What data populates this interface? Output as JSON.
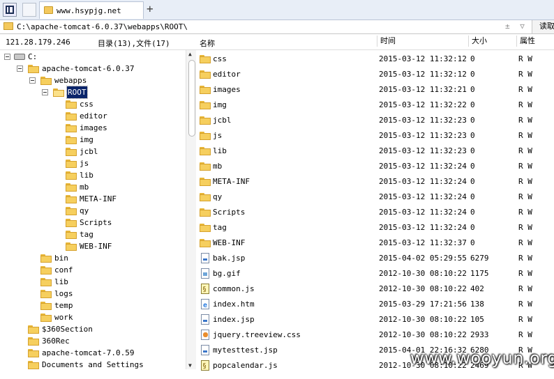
{
  "tab": {
    "label": "www.hsypjg.net",
    "new_tab": "+"
  },
  "address": {
    "path": "C:\\apache-tomcat-6.0.37\\webapps\\ROOT\\",
    "arrows": "± ▽",
    "read_button": "读取"
  },
  "info": {
    "ip": "121.28.179.246",
    "counts": "目录(13),文件(17)",
    "headers": {
      "name": "名称",
      "time": "时间",
      "size": "大小",
      "attr": "属性"
    }
  },
  "tree": [
    {
      "label": "C:",
      "depth": 0,
      "kind": "drive",
      "expanded": true
    },
    {
      "label": "apache-tomcat-6.0.37",
      "depth": 1,
      "kind": "folder",
      "expanded": true
    },
    {
      "label": "webapps",
      "depth": 2,
      "kind": "folder",
      "expanded": true
    },
    {
      "label": "ROOT",
      "depth": 3,
      "kind": "folder-open",
      "expanded": true,
      "selected": true
    },
    {
      "label": "css",
      "depth": 4,
      "kind": "folder"
    },
    {
      "label": "editor",
      "depth": 4,
      "kind": "folder"
    },
    {
      "label": "images",
      "depth": 4,
      "kind": "folder"
    },
    {
      "label": "img",
      "depth": 4,
      "kind": "folder"
    },
    {
      "label": "jcbl",
      "depth": 4,
      "kind": "folder"
    },
    {
      "label": "js",
      "depth": 4,
      "kind": "folder"
    },
    {
      "label": "lib",
      "depth": 4,
      "kind": "folder"
    },
    {
      "label": "mb",
      "depth": 4,
      "kind": "folder"
    },
    {
      "label": "META-INF",
      "depth": 4,
      "kind": "folder"
    },
    {
      "label": "qy",
      "depth": 4,
      "kind": "folder"
    },
    {
      "label": "Scripts",
      "depth": 4,
      "kind": "folder"
    },
    {
      "label": "tag",
      "depth": 4,
      "kind": "folder"
    },
    {
      "label": "WEB-INF",
      "depth": 4,
      "kind": "folder"
    },
    {
      "label": "bin",
      "depth": 2.5,
      "kind": "folder"
    },
    {
      "label": "conf",
      "depth": 2.5,
      "kind": "folder"
    },
    {
      "label": "lib",
      "depth": 2.5,
      "kind": "folder"
    },
    {
      "label": "logs",
      "depth": 2.5,
      "kind": "folder"
    },
    {
      "label": "temp",
      "depth": 2.5,
      "kind": "folder"
    },
    {
      "label": "work",
      "depth": 2.5,
      "kind": "folder"
    },
    {
      "label": "$360Section",
      "depth": 1.5,
      "kind": "folder"
    },
    {
      "label": "360Rec",
      "depth": 1.5,
      "kind": "folder"
    },
    {
      "label": "apache-tomcat-7.0.59",
      "depth": 1.5,
      "kind": "folder"
    },
    {
      "label": "Documents and Settings",
      "depth": 1.5,
      "kind": "folder"
    }
  ],
  "files": [
    {
      "name": "css",
      "time": "2015-03-12 11:32:12",
      "size": "0",
      "attr": "R W",
      "icon": "folder"
    },
    {
      "name": "editor",
      "time": "2015-03-12 11:32:12",
      "size": "0",
      "attr": "R W",
      "icon": "folder"
    },
    {
      "name": "images",
      "time": "2015-03-12 11:32:21",
      "size": "0",
      "attr": "R W",
      "icon": "folder"
    },
    {
      "name": "img",
      "time": "2015-03-12 11:32:22",
      "size": "0",
      "attr": "R W",
      "icon": "folder"
    },
    {
      "name": "jcbl",
      "time": "2015-03-12 11:32:23",
      "size": "0",
      "attr": "R W",
      "icon": "folder"
    },
    {
      "name": "js",
      "time": "2015-03-12 11:32:23",
      "size": "0",
      "attr": "R W",
      "icon": "folder"
    },
    {
      "name": "lib",
      "time": "2015-03-12 11:32:23",
      "size": "0",
      "attr": "R W",
      "icon": "folder"
    },
    {
      "name": "mb",
      "time": "2015-03-12 11:32:24",
      "size": "0",
      "attr": "R W",
      "icon": "folder"
    },
    {
      "name": "META-INF",
      "time": "2015-03-12 11:32:24",
      "size": "0",
      "attr": "R W",
      "icon": "folder"
    },
    {
      "name": "qy",
      "time": "2015-03-12 11:32:24",
      "size": "0",
      "attr": "R W",
      "icon": "folder"
    },
    {
      "name": "Scripts",
      "time": "2015-03-12 11:32:24",
      "size": "0",
      "attr": "R W",
      "icon": "folder"
    },
    {
      "name": "tag",
      "time": "2015-03-12 11:32:24",
      "size": "0",
      "attr": "R W",
      "icon": "folder"
    },
    {
      "name": "WEB-INF",
      "time": "2015-03-12 11:32:37",
      "size": "0",
      "attr": "R W",
      "icon": "folder"
    },
    {
      "name": "bak.jsp",
      "time": "2015-04-02 05:29:55",
      "size": "6279",
      "attr": "R W",
      "icon": "jsp"
    },
    {
      "name": "bg.gif",
      "time": "2012-10-30 08:10:22",
      "size": "1175",
      "attr": "R W",
      "icon": "gif"
    },
    {
      "name": "common.js",
      "time": "2012-10-30 08:10:22",
      "size": "402",
      "attr": "R W",
      "icon": "js"
    },
    {
      "name": "index.htm",
      "time": "2015-03-29 17:21:56",
      "size": "138",
      "attr": "R W",
      "icon": "htm"
    },
    {
      "name": "index.jsp",
      "time": "2012-10-30 08:10:22",
      "size": "105",
      "attr": "R W",
      "icon": "jsp"
    },
    {
      "name": "jquery.treeview.css",
      "time": "2012-10-30 08:10:22",
      "size": "2933",
      "attr": "R W",
      "icon": "css"
    },
    {
      "name": "mytesttest.jsp",
      "time": "2015-04-01 22:16:32",
      "size": "6280",
      "attr": "R W",
      "icon": "jsp"
    },
    {
      "name": "popcalendar.js",
      "time": "2012-10-30 08:10:22",
      "size": "2469",
      "attr": "R W",
      "icon": "js"
    }
  ],
  "watermark": "www.wooyun.org"
}
